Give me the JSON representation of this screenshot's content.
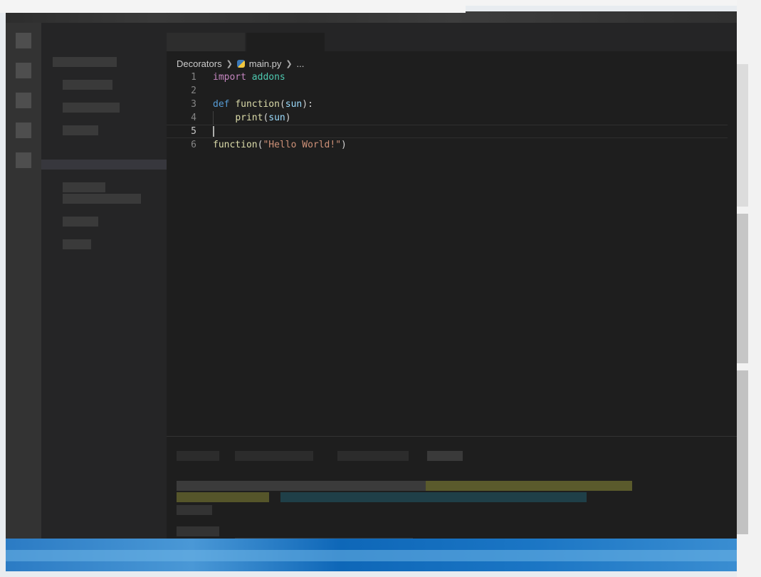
{
  "editor": {
    "breadcrumb": {
      "folder": "Decorators",
      "file": "main.py",
      "symbol": "..."
    },
    "lines": [
      {
        "number": "1",
        "tokens": [
          {
            "text": "import",
            "kind": "kw-import"
          },
          {
            "text": " ",
            "kind": ""
          },
          {
            "text": "addons",
            "kind": "mod"
          }
        ]
      },
      {
        "number": "2",
        "tokens": []
      },
      {
        "number": "3",
        "tokens": [
          {
            "text": "def",
            "kind": "kw-def"
          },
          {
            "text": " ",
            "kind": ""
          },
          {
            "text": "function",
            "kind": "fn"
          },
          {
            "text": "(",
            "kind": ""
          },
          {
            "text": "sun",
            "kind": "param"
          },
          {
            "text": "):",
            "kind": ""
          }
        ]
      },
      {
        "number": "4",
        "tokens": [
          {
            "text": "    ",
            "kind": ""
          },
          {
            "text": "print",
            "kind": "fn"
          },
          {
            "text": "(",
            "kind": ""
          },
          {
            "text": "sun",
            "kind": "param"
          },
          {
            "text": ")",
            "kind": ""
          }
        ]
      },
      {
        "number": "5",
        "tokens": []
      },
      {
        "number": "6",
        "tokens": [
          {
            "text": "function",
            "kind": "fn"
          },
          {
            "text": "(",
            "kind": ""
          },
          {
            "text": "\"Hello World!\"",
            "kind": "str"
          },
          {
            "text": ")",
            "kind": ""
          }
        ]
      }
    ],
    "current_line": "5"
  },
  "colors": {
    "editor_bg": "#1e1e1e",
    "keyword_import": "#c586c0",
    "keyword_def": "#569cd6",
    "module": "#4ec9b0",
    "function": "#dcdcaa",
    "parameter": "#9cdcfe",
    "string": "#ce9178",
    "status_bar": "#0e67b8"
  },
  "icons": {
    "file_icon": "python-file-icon",
    "separator": "chevron-right-icon"
  }
}
